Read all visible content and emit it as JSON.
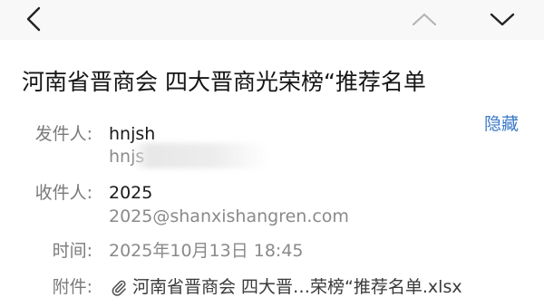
{
  "nav": {
    "back_icon": "chevron-left-icon",
    "prev_icon": "chevron-up-icon",
    "next_icon": "chevron-down-icon"
  },
  "subject": "河南省晋商会 四大晋商光荣榜“推荐名单",
  "sender": {
    "label": "发件人:",
    "name": "hnjsh",
    "address_visible": "hnjs",
    "hide_label": "隐藏"
  },
  "recipient": {
    "label": "收件人:",
    "name": "2025",
    "address": "2025@shanxishangren.com"
  },
  "time": {
    "label": "时间:",
    "value": "2025年10月13日 18:45"
  },
  "attachment": {
    "label": "附件:",
    "icon": "paperclip-icon",
    "filename": "河南省晋商会 四大晋…荣榜“推荐名单.xlsx"
  },
  "colors": {
    "link": "#3a79c7",
    "label": "#7a7a7a",
    "text": "#1a1a1a",
    "topbar": "#f8f8f8"
  }
}
